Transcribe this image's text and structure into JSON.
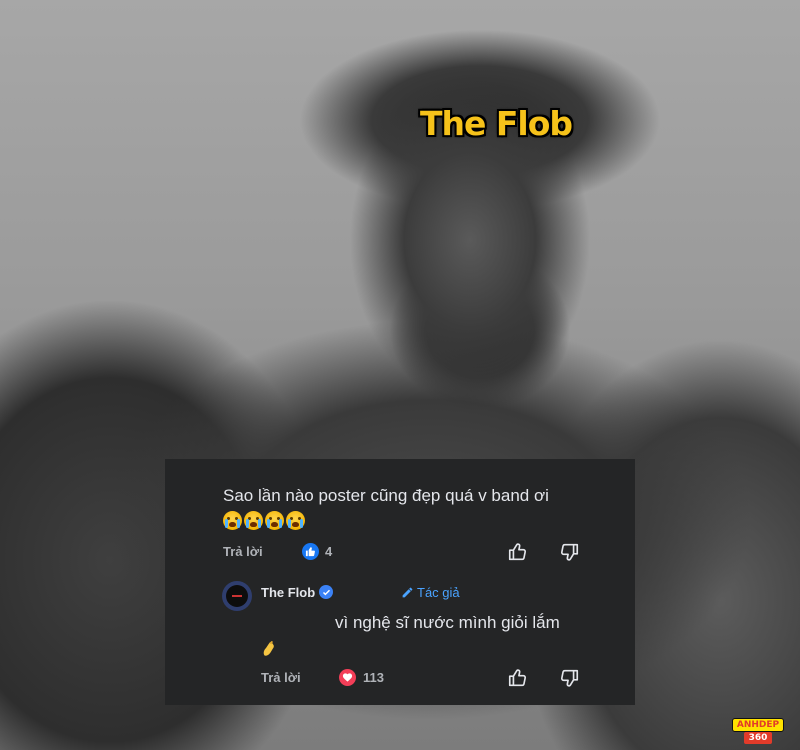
{
  "photo": {
    "caption": "The Flob",
    "caption_color": "#f6c21a"
  },
  "comments": [
    {
      "text": "Sao lần nào poster cũng đẹp quá v band ơi",
      "emojis": [
        "loudly-crying-face",
        "loudly-crying-face",
        "loudly-crying-face",
        "loudly-crying-face"
      ],
      "reply_label": "Trả lời",
      "reaction": "like",
      "reaction_count": "4"
    },
    {
      "author": "The Flob",
      "verified": true,
      "author_badge": "Tác giả",
      "text": "vì nghệ sĩ nước mình giỏi lắm",
      "emojis": [
        "pinched-fingers"
      ],
      "reply_label": "Trả lời",
      "reaction": "love",
      "reaction_count": "113"
    }
  ],
  "watermark": {
    "top": "ANHDEP",
    "bottom": "360"
  },
  "colors": {
    "card_bg": "#242526",
    "text": "#e4e6eb",
    "muted": "#b0b3b8",
    "link": "#4aa3ff",
    "like_blue": "#1877f2",
    "love_red": "#f33e58"
  }
}
